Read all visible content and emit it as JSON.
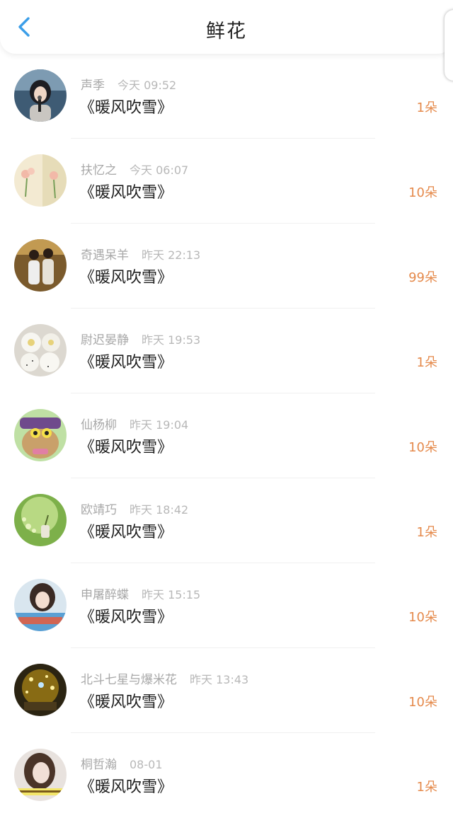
{
  "header": {
    "title": "鲜花",
    "back_icon": "chevron-left-icon",
    "accent_color": "#3b9ee8"
  },
  "items": [
    {
      "user": "声季",
      "time": "今天 09:52",
      "work": "《暖风吹雪》",
      "count": "1朵",
      "avatar": "girl-at-microphone"
    },
    {
      "user": "扶忆之",
      "time": "今天 06:07",
      "work": "《暖风吹雪》",
      "count": "10朵",
      "avatar": "pink-flowers"
    },
    {
      "user": "奇遇呆羊",
      "time": "昨天 22:13",
      "work": "《暖风吹雪》",
      "count": "99朵",
      "avatar": "two-people-photo"
    },
    {
      "user": "尉迟晏静",
      "time": "昨天 19:53",
      "work": "《暖风吹雪》",
      "count": "1朵",
      "avatar": "steamed-buns"
    },
    {
      "user": "仙杨柳",
      "time": "昨天 19:04",
      "work": "《暖风吹雪》",
      "count": "10朵",
      "avatar": "cartoon-character"
    },
    {
      "user": "欧靖巧",
      "time": "昨天 18:42",
      "work": "《暖风吹雪》",
      "count": "1朵",
      "avatar": "green-bokeh"
    },
    {
      "user": "申屠醉蝶",
      "time": "昨天 15:15",
      "work": "《暖风吹雪》",
      "count": "10朵",
      "avatar": "girl-portrait"
    },
    {
      "user": "北斗七星与爆米花",
      "time": "昨天 13:43",
      "work": "《暖风吹雪》",
      "count": "10朵",
      "avatar": "golden-sparkles"
    },
    {
      "user": "桐哲瀚",
      "time": "08-01",
      "work": "《暖风吹雪》",
      "count": "1朵",
      "avatar": "girl-with-caption"
    }
  ],
  "colors": {
    "count": "#e58a4c",
    "name": "#a8a8a8",
    "work": "#1e1e1e"
  }
}
